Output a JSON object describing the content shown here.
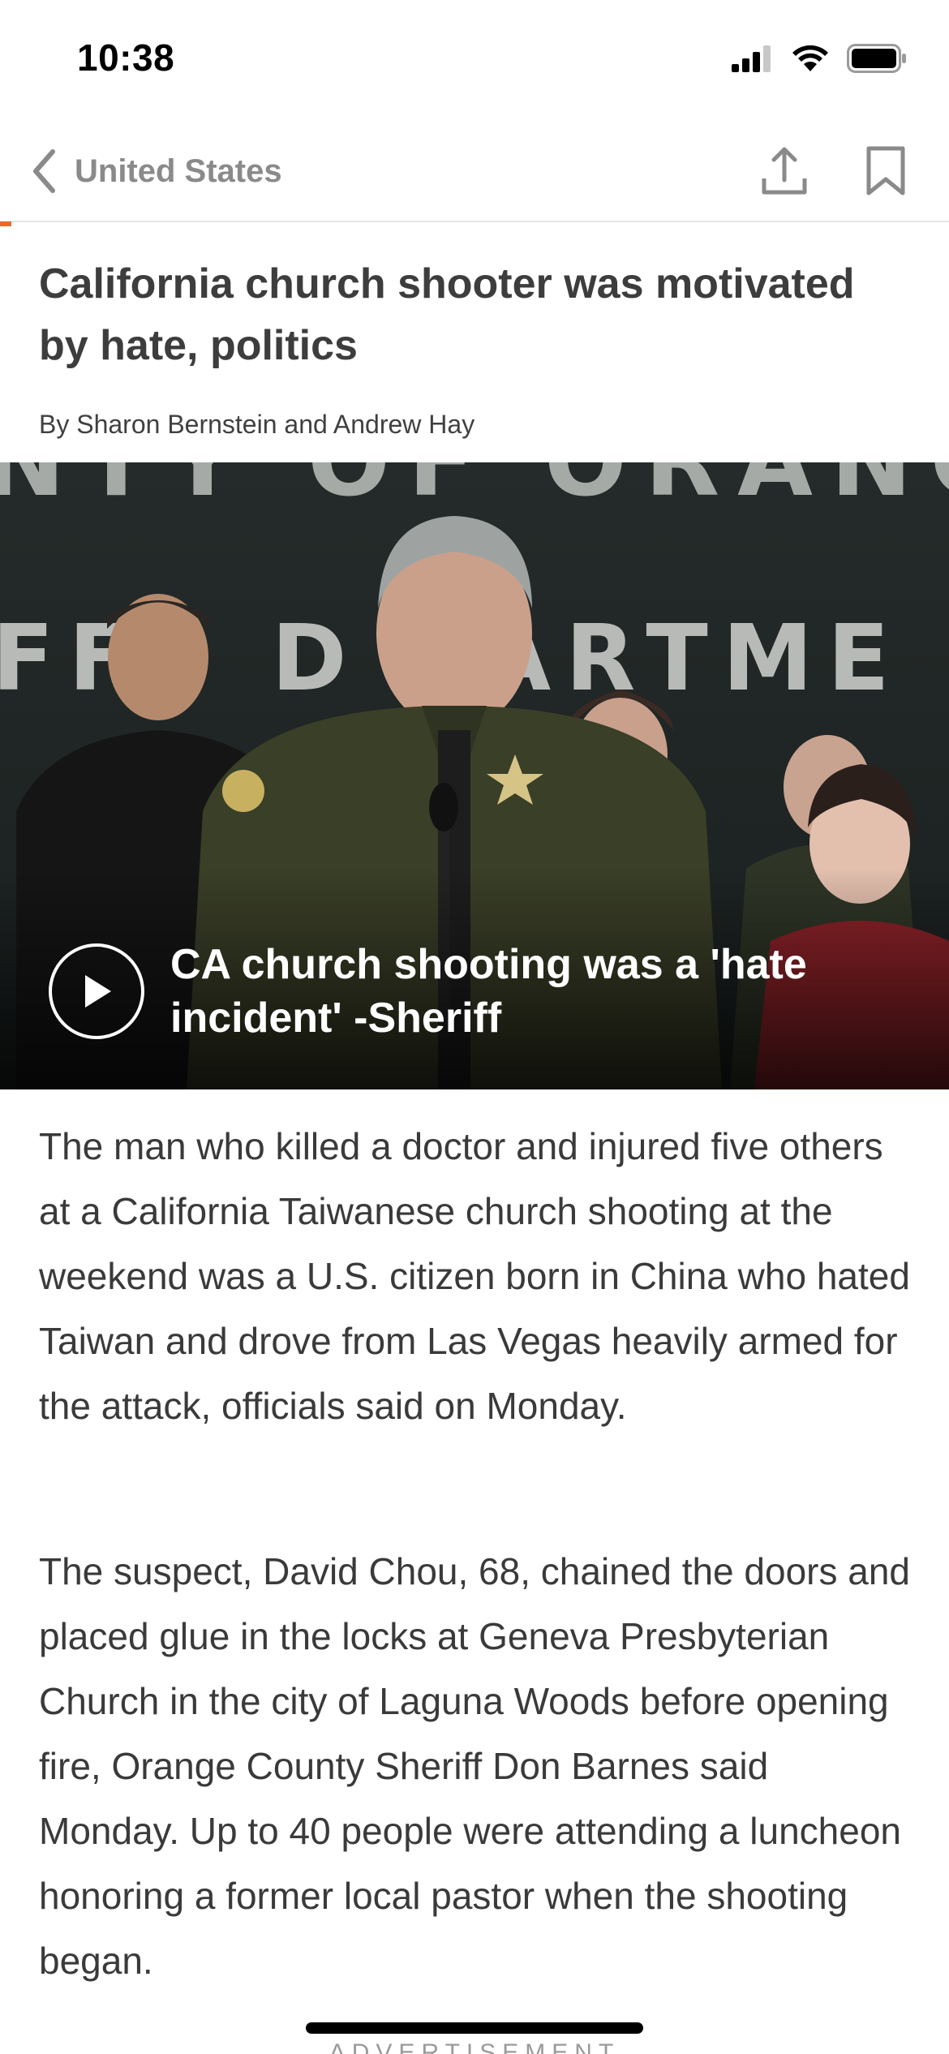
{
  "status_bar": {
    "time": "10:38",
    "icons": [
      "cellular-signal-icon",
      "wifi-icon",
      "battery-icon"
    ]
  },
  "nav": {
    "back_icon": "chevron-left-icon",
    "back_label": "United States",
    "share_icon": "share-icon",
    "bookmark_icon": "bookmark-icon",
    "accent_color": "#e86a2a"
  },
  "article": {
    "headline": "California church shooter was motivated by hate, politics",
    "byline": "By Sharon Bernstein and Andrew Hay",
    "video": {
      "play_icon": "play-icon",
      "title": "CA church shooting was a 'hate incident' -Sheriff",
      "backdrop_text_top": "NTY OF ORANG",
      "backdrop_text_middle": "FFS D PARTME"
    },
    "paragraphs": [
      "The man who killed a doctor and injured five others at a California Taiwanese church shooting at the weekend was a U.S. citizen born in China who hated Taiwan and drove from Las Vegas heavily armed for the attack, officials said on Monday.",
      "The suspect, David Chou, 68, chained the doors and placed glue in the locks at Geneva Presbyterian Church in the city of Laguna Woods before opening fire, Orange County Sheriff Don Barnes said Monday. Up to 40 people were attending a luncheon honoring a former local pastor when the shooting began."
    ],
    "advertisement_label": "ADVERTISEMENT"
  }
}
